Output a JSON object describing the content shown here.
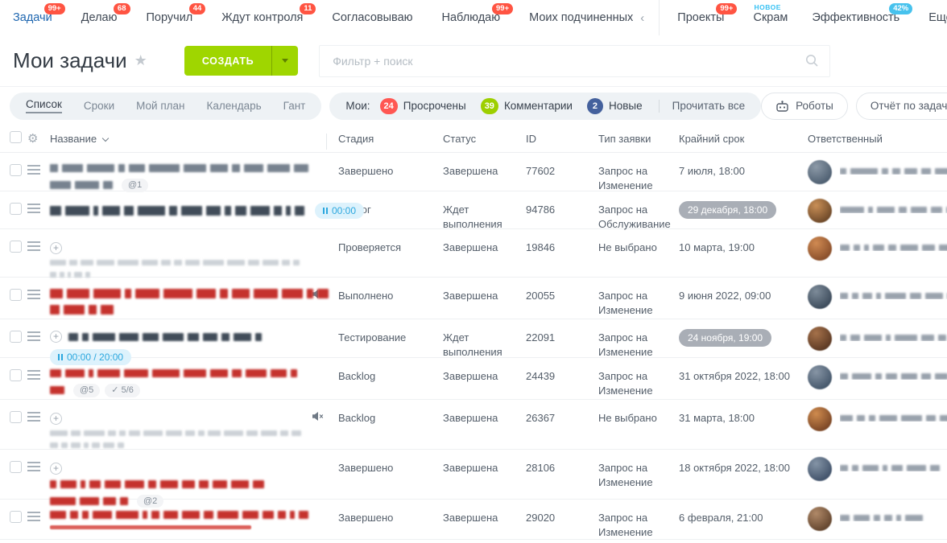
{
  "colors": {
    "accent_blue": "#1f67b0",
    "badge_red": "#ff5442",
    "badge_lightblue": "#47c2ed",
    "create_green": "#9fd600",
    "timer_blue": "#2ba7de",
    "deadline_pill_gray": "#a9aeb6"
  },
  "name_colors": {
    "slate": "#77828f",
    "dark": "#414c59",
    "red": "#c5322d",
    "gray": "#bcc3ca"
  },
  "nav": {
    "items": [
      {
        "label": "Задачи",
        "badge": "99+"
      },
      {
        "label": "Делаю",
        "badge": "68"
      },
      {
        "label": "Поручил",
        "badge": "44"
      },
      {
        "label": "Ждут контроля",
        "badge": "11"
      },
      {
        "label": "Согласовываю"
      },
      {
        "label": "Наблюдаю",
        "badge": "99+"
      },
      {
        "label": "Моих подчиненных",
        "chevron": "‹"
      }
    ],
    "items_right": [
      {
        "label": "Проекты",
        "badge": "99+"
      },
      {
        "label": "Скрам",
        "tag": "НОВОЕ"
      },
      {
        "label": "Эффективность",
        "badge": "42%"
      },
      {
        "label": "Еще"
      }
    ]
  },
  "toolbar": {
    "title": "Мои задачи",
    "star": "★",
    "create_label": "СОЗДАТЬ",
    "search_placeholder": "Фильтр + поиск"
  },
  "tabs": {
    "views": [
      "Список",
      "Сроки",
      "Мой план",
      "Календарь",
      "Гант"
    ],
    "active_view": "Список",
    "counters": {
      "label": "Мои:",
      "items": [
        {
          "count": "24",
          "color": "#ff5752",
          "label": "Просрочены"
        },
        {
          "count": "39",
          "color": "#9dcf00",
          "label": "Комментарии"
        },
        {
          "count": "2",
          "color": "#44619d",
          "label": "Новые"
        }
      ],
      "read_all": "Прочитать все"
    },
    "right_buttons": [
      {
        "label": "Роботы",
        "icon": "robot-icon"
      },
      {
        "label": "Отчёт по задачам Битри"
      }
    ]
  },
  "table": {
    "columns": [
      "Название",
      "Стадия",
      "Статус",
      "ID",
      "Тип заявки",
      "Крайний срок",
      "Ответственный"
    ]
  },
  "rows": [
    {
      "stage": "Завершено",
      "status": "Завершена",
      "id": "77602",
      "type": "Запрос на Изменение",
      "deadline": "7 июля, 18:00",
      "pill": false,
      "h": 48,
      "name": {
        "color": "slate",
        "lines": [
          [
            10,
            26,
            34,
            8,
            20,
            38,
            28,
            22,
            10,
            24,
            28,
            18
          ],
          [
            26,
            30,
            12
          ]
        ],
        "chips": [
          {
            "t": "1",
            "icon": "clip"
          }
        ]
      },
      "resp": [
        8,
        34,
        8,
        10,
        16,
        12,
        20
      ],
      "avatar": [
        "#8d9aa8",
        "#4f6072"
      ]
    },
    {
      "stage": "Бэклог",
      "status": "Ждет выполнения",
      "id": "94786",
      "type": "Запрос на Обслуживание",
      "deadline": "29 декабря, 18:00",
      "pill": true,
      "h": 47,
      "name": {
        "color": "dark",
        "bold": true,
        "lines": [
          [
            14,
            30,
            6,
            22,
            12,
            34,
            10,
            26,
            18,
            8,
            14,
            24,
            10,
            6,
            12
          ]
        ],
        "timer": "00:00",
        "timer_inline": true
      },
      "resp": [
        30,
        6,
        22,
        10,
        20,
        14,
        14
      ],
      "avatar": [
        "#c98f56",
        "#6f4a2a"
      ]
    },
    {
      "stage": "Проверяется",
      "status": "Завершена",
      "id": "19846",
      "type": "Не выбрано",
      "deadline": "10 марта, 19:00",
      "pill": false,
      "h": 60,
      "name": {
        "color": "gray",
        "expand": "block",
        "small": true,
        "lines": [
          [
            20,
            10,
            16,
            22,
            26,
            20,
            12,
            10,
            18,
            26,
            22,
            14,
            20,
            10,
            8
          ],
          [
            8,
            6,
            4,
            10,
            6
          ]
        ]
      },
      "resp": [
        12,
        8,
        6,
        14,
        10,
        22,
        16,
        20
      ],
      "avatar": [
        "#d08a52",
        "#8a4f2b"
      ]
    },
    {
      "stage": "Выполнено",
      "status": "Завершена",
      "id": "20055",
      "type": "Запрос на Изменение",
      "deadline": "9 июня 2022, 09:00",
      "pill": false,
      "h": 52,
      "muted": true,
      "name": {
        "color": "red",
        "bold": true,
        "lines": [
          [
            16,
            28,
            34,
            8,
            30,
            36,
            24,
            10,
            22,
            30,
            26,
            8,
            14
          ],
          [
            12,
            26,
            10,
            16
          ]
        ]
      },
      "resp": [
        10,
        8,
        12,
        6,
        26,
        14,
        22,
        18
      ],
      "avatar": [
        "#7d8b99",
        "#3d4c5c"
      ]
    },
    {
      "stage": "Тестирование",
      "status": "Ждет выполнения",
      "id": "22091",
      "type": "Запрос на Изменение",
      "deadline": "24 ноября, 19:00",
      "pill": true,
      "h": 48,
      "name": {
        "color": "dark",
        "expand": "inline",
        "lines": [
          [
            12,
            8,
            28,
            24,
            20,
            26,
            14,
            18,
            10,
            22,
            8
          ]
        ],
        "timer": "00:00 / 20:00"
      },
      "resp": [
        8,
        12,
        22,
        6,
        28,
        16,
        10
      ],
      "avatar": [
        "#a5714a",
        "#5d3a24"
      ]
    },
    {
      "stage": "Backlog",
      "status": "Завершена",
      "id": "24439",
      "type": "Запрос на Изменение",
      "deadline": "31 октября 2022, 18:00",
      "pill": false,
      "h": 52,
      "name": {
        "color": "red",
        "lines": [
          [
            14,
            24,
            6,
            28,
            30,
            34,
            28,
            22,
            12,
            26,
            20,
            8
          ],
          [
            18
          ]
        ],
        "chips": [
          {
            "t": "5",
            "icon": "clip"
          },
          {
            "t": "5/6",
            "icon": "check"
          }
        ]
      },
      "resp": [
        10,
        24,
        8,
        14,
        20,
        12,
        16
      ],
      "avatar": [
        "#8795a5",
        "#46586c"
      ]
    },
    {
      "stage": "Backlog",
      "status": "Завершена",
      "id": "26367",
      "type": "Не выбрано",
      "deadline": "31 марта, 18:00",
      "pill": false,
      "h": 62,
      "muted": true,
      "name": {
        "color": "gray",
        "expand": "block",
        "small": true,
        "lines": [
          [
            22,
            12,
            26,
            10,
            8,
            14,
            24,
            20,
            12,
            8,
            16,
            24,
            14,
            20,
            10,
            12
          ],
          [
            10,
            8,
            12,
            6,
            10,
            14,
            8
          ]
        ]
      },
      "resp": [
        16,
        10,
        8,
        22,
        26,
        12,
        18
      ],
      "avatar": [
        "#cf8b4e",
        "#7c4726"
      ]
    },
    {
      "stage": "Завершено",
      "status": "Завершена",
      "id": "28106",
      "type": "Запрос на Изменение",
      "deadline": "18 октября 2022, 18:00",
      "pill": false,
      "h": 62,
      "name": {
        "color": "red",
        "expand": "block",
        "lines": [
          [
            8,
            20,
            6,
            14,
            20,
            24,
            10,
            22,
            16,
            12,
            18,
            22,
            14
          ],
          [
            32,
            24,
            16,
            10
          ]
        ],
        "chips": [
          {
            "t": "2",
            "icon": "clip"
          }
        ]
      },
      "resp": [
        10,
        8,
        20,
        6,
        14,
        24,
        12
      ],
      "avatar": [
        "#8494a6",
        "#42536b"
      ]
    },
    {
      "stage": "Завершено",
      "status": "Завершена",
      "id": "29020",
      "type": "Запрос на Изменение",
      "deadline": "6 февраля, 21:00",
      "pill": false,
      "h": 50,
      "name": {
        "color": "red",
        "lines": [
          [
            20,
            10,
            8,
            24,
            28,
            6,
            10,
            18,
            22,
            12,
            26,
            20,
            14,
            10,
            6,
            12
          ]
        ],
        "solid": 250
      },
      "resp": [
        12,
        20,
        8,
        10,
        6,
        22
      ],
      "avatar": [
        "#b08968",
        "#64462f"
      ]
    }
  ]
}
